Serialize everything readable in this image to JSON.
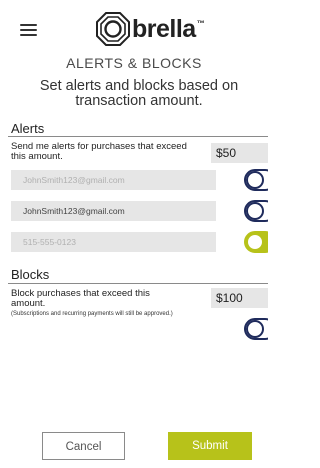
{
  "header": {
    "menu_icon": "hamburger-menu-icon",
    "logo_icon": "brella-octagon-logo-icon",
    "logo_text": "brella",
    "logo_tm": "™"
  },
  "screen": {
    "title": "ALERTS & BLOCKS",
    "subtitle": "Set alerts and blocks based on transaction amount."
  },
  "alerts": {
    "section_label": "Alerts",
    "description": "Send me alerts for purchases that exceed this amount.",
    "amount": "$50",
    "fields": [
      {
        "value": "JohnSmith123@gmail.com",
        "style": "placeholder",
        "toggle_on": false
      },
      {
        "value": "JohnSmith123@gmail.com",
        "style": "filled",
        "toggle_on": false
      },
      {
        "value": "515-555-0123",
        "style": "placeholder",
        "toggle_on": true
      }
    ]
  },
  "blocks": {
    "section_label": "Blocks",
    "description": "Block purchases that exceed this amount.",
    "note": "(Subscriptions and recurring payments will still be approved.)",
    "amount": "$100",
    "toggle_on": false
  },
  "actions": {
    "cancel_label": "Cancel",
    "submit_label": "Submit"
  },
  "colors": {
    "accent": "#b7c21a",
    "toggle_border": "#1f2b5c",
    "field_bg": "#e6e6e6"
  }
}
